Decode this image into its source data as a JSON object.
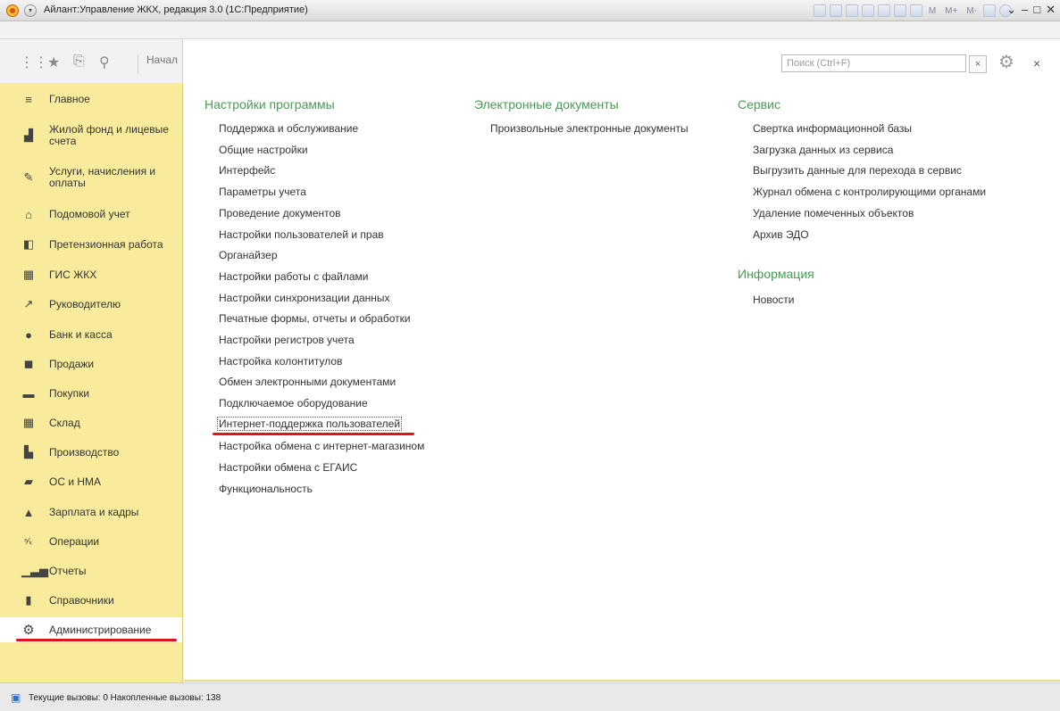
{
  "window": {
    "title": "Айлант:Управление ЖКХ, редакция 3.0  (1С:Предприятие)",
    "tool_labels": [
      "M",
      "M+",
      "M-"
    ]
  },
  "topbar": {
    "start_label": "Начал"
  },
  "sidebar": {
    "items": [
      {
        "label": "Главное",
        "icon": "list-icon"
      },
      {
        "label": "Жилой фонд и лицевые счета",
        "icon": "housing-icon"
      },
      {
        "label": "Услуги, начисления и оплаты",
        "icon": "pencil-icon"
      },
      {
        "label": "Подомовой учет",
        "icon": "house-icon"
      },
      {
        "label": "Претензионная работа",
        "icon": "claim-icon"
      },
      {
        "label": "ГИС ЖКХ",
        "icon": "building-icon"
      },
      {
        "label": "Руководителю",
        "icon": "trend-icon"
      },
      {
        "label": "Банк и касса",
        "icon": "ruble-icon"
      },
      {
        "label": "Продажи",
        "icon": "bag-icon"
      },
      {
        "label": "Покупки",
        "icon": "cart-icon"
      },
      {
        "label": "Склад",
        "icon": "warehouse-icon"
      },
      {
        "label": "Производство",
        "icon": "factory-icon"
      },
      {
        "label": "ОС и НМА",
        "icon": "truck-icon"
      },
      {
        "label": "Зарплата и кадры",
        "icon": "person-icon"
      },
      {
        "label": "Операции",
        "icon": "dt-kt-icon"
      },
      {
        "label": "Отчеты",
        "icon": "bar-chart-icon"
      },
      {
        "label": "Справочники",
        "icon": "book-icon"
      },
      {
        "label": "Администрирование",
        "icon": "gear-icon",
        "active": true
      }
    ]
  },
  "search": {
    "placeholder": "Поиск (Ctrl+F)",
    "clear_label": "×"
  },
  "close_label": "×",
  "sections": {
    "settings": {
      "title": "Настройки программы",
      "links": [
        "Поддержка и обслуживание",
        "Общие настройки",
        "Интерфейс",
        "Параметры учета",
        "Проведение документов",
        "Настройки пользователей и прав",
        "Органайзер",
        "Настройки работы с файлами",
        "Настройки синхронизации данных",
        "Печатные формы, отчеты и обработки",
        "Настройки регистров учета",
        "Настройка колонтитулов",
        "Обмен электронными документами",
        "Подключаемое оборудование",
        "Интернет-поддержка пользователей",
        "Настройка обмена с интернет-магазином",
        "Настройки обмена с ЕГАИС",
        "Функциональность"
      ]
    },
    "edocs": {
      "title": "Электронные документы",
      "links": [
        "Произвольные электронные документы"
      ]
    },
    "service": {
      "title": "Сервис",
      "links": [
        "Свертка информационной базы",
        "Загрузка данных из сервиса",
        "Выгрузить данные для перехода в сервис",
        "Журнал обмена с контролирующими органами",
        "Удаление помеченных объектов",
        "Архив ЭДО"
      ]
    },
    "info": {
      "title": "Информация",
      "links": [
        "Новости"
      ]
    }
  },
  "status": {
    "text": "Текущие вызовы: 0   Накопленные вызовы: 138"
  }
}
